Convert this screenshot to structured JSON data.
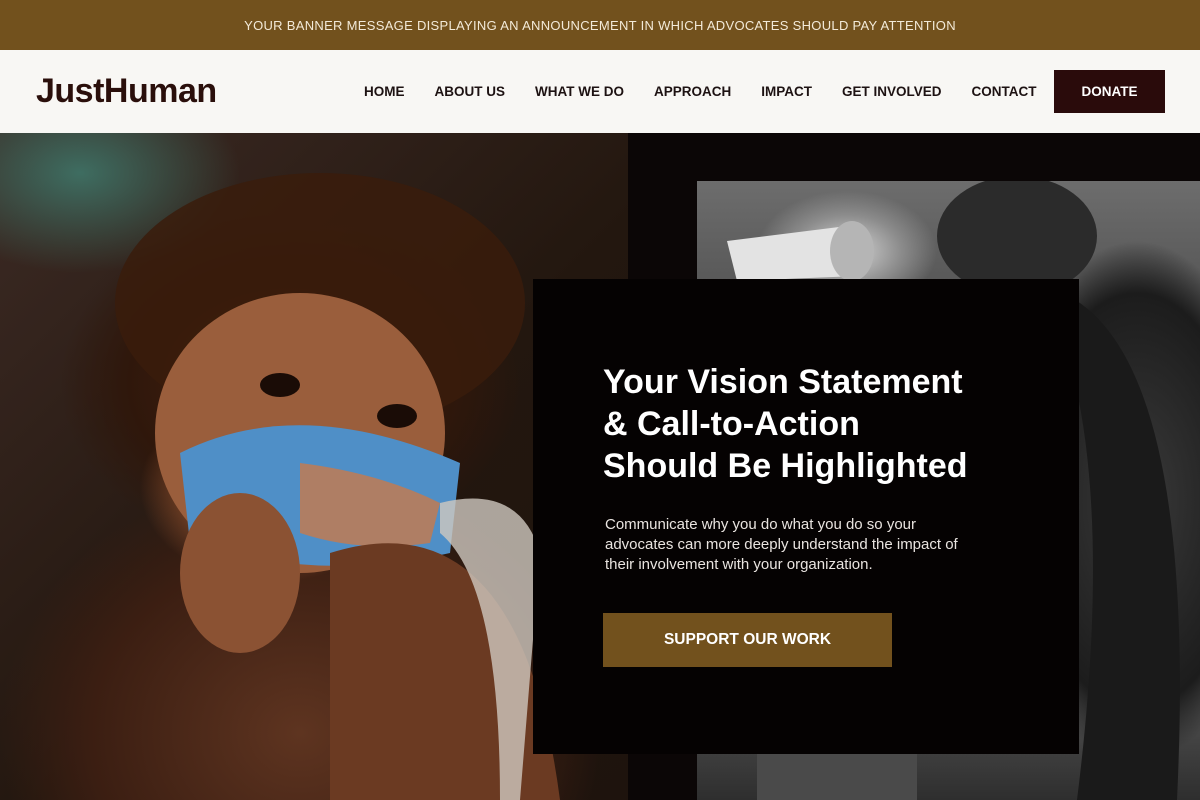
{
  "banner": {
    "message": "YOUR BANNER MESSAGE DISPLAYING AN ANNOUNCEMENT IN WHICH ADVOCATES SHOULD PAY ATTENTION"
  },
  "header": {
    "logo": "JustHuman",
    "nav": [
      {
        "label": "HOME"
      },
      {
        "label": "ABOUT US"
      },
      {
        "label": "WHAT WE DO"
      },
      {
        "label": "APPROACH"
      },
      {
        "label": "IMPACT"
      },
      {
        "label": "GET INVOLVED"
      },
      {
        "label": "CONTACT"
      }
    ],
    "donate_label": "DONATE"
  },
  "hero": {
    "title": "Your Vision Statement\n& Call-to-Action\nShould Be Highlighted",
    "body": "Communicate why you do what you do so your advocates can more deeply understand the impact of their involvement with your organization.",
    "cta_label": "SUPPORT OUR WORK"
  },
  "colors": {
    "brand_gold": "#72511d",
    "brand_dark": "#2a0b0b",
    "card_bg": "#050202",
    "nav_bg": "#f8f7f4"
  }
}
